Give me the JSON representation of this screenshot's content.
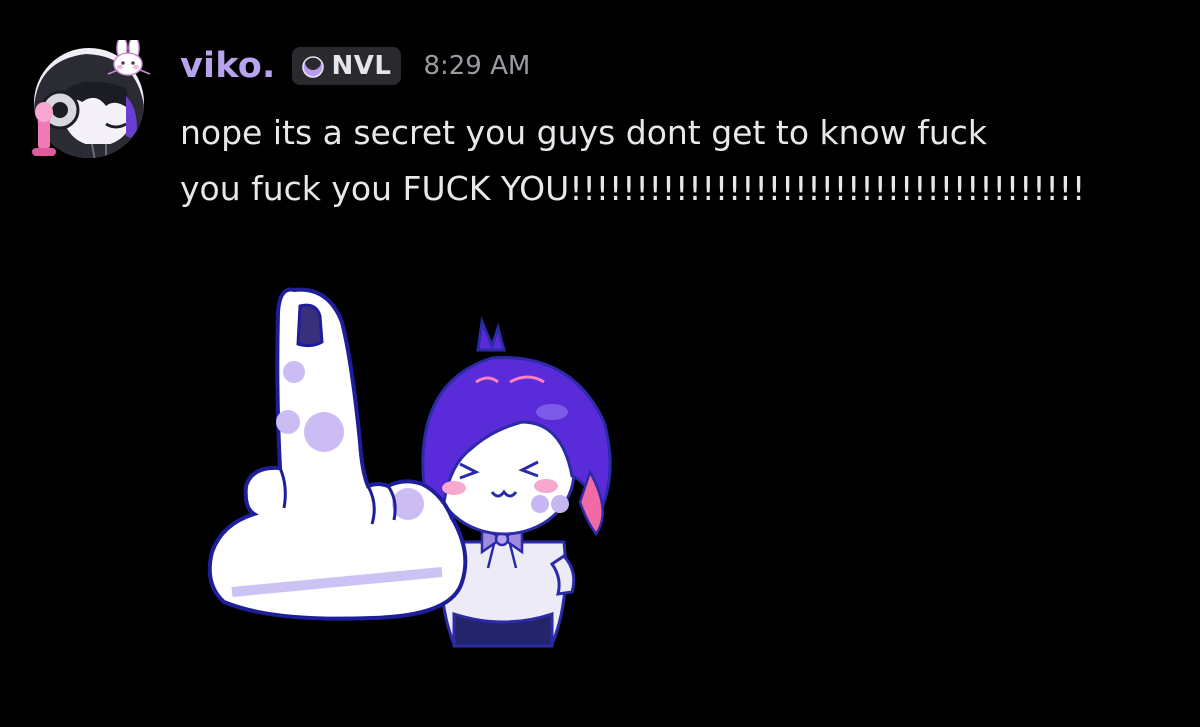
{
  "message": {
    "author": {
      "display_name": "viko.",
      "name_color": "#b8a4ee",
      "avatar_icon": "avatar-bunny-character"
    },
    "guild_tag": {
      "text": "NVL",
      "icon": "moon-crescent-icon"
    },
    "timestamp": "8:29 AM",
    "content_line_1": "nope its a secret you guys dont get to know fuck",
    "content_line_2": "you fuck you FUCK YOU!!!!!!!!!!!!!!!!!!!!!!!!!!!!!!!!!!!!!!!",
    "sticker": {
      "icon": "middle-finger-sticker"
    }
  },
  "colors": {
    "background": "#000000",
    "text": "#e8e8ec",
    "timestamp": "#9a9aa3",
    "tag_background": "#2a2a2e",
    "accent_purple": "#6a2fd8"
  }
}
